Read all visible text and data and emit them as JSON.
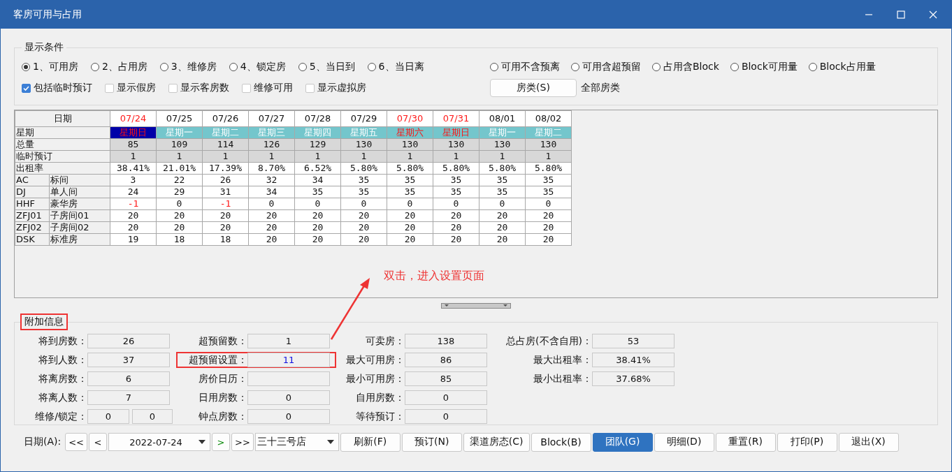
{
  "window": {
    "title": "客房可用与占用"
  },
  "conditions": {
    "title": "显示条件",
    "radios_left": [
      {
        "label": "1、可用房",
        "selected": true
      },
      {
        "label": "2、占用房",
        "selected": false
      },
      {
        "label": "3、维修房",
        "selected": false
      },
      {
        "label": "4、锁定房",
        "selected": false
      },
      {
        "label": "5、当日到",
        "selected": false
      },
      {
        "label": "6、当日离",
        "selected": false
      }
    ],
    "radios_right": [
      {
        "label": "可用不含预离",
        "selected": false
      },
      {
        "label": "可用含超预留",
        "selected": false
      },
      {
        "label": "占用含Block",
        "selected": false
      },
      {
        "label": "Block可用量",
        "selected": false
      },
      {
        "label": "Block占用量",
        "selected": false
      }
    ],
    "checkboxes": [
      {
        "label": "包括临时预订",
        "checked": true
      },
      {
        "label": "显示假房",
        "checked": false
      },
      {
        "label": "显示客房数",
        "checked": false
      },
      {
        "label": "维修可用",
        "checked": false
      },
      {
        "label": "显示虚拟房",
        "checked": false
      }
    ],
    "room_type_button": "房类(S)",
    "room_type_value": "全部房类"
  },
  "grid": {
    "header": "日期",
    "columns": [
      {
        "date": "07/24",
        "weekday": "星期日",
        "weekend": true,
        "selected": true
      },
      {
        "date": "07/25",
        "weekday": "星期一",
        "weekend": false,
        "selected": false
      },
      {
        "date": "07/26",
        "weekday": "星期二",
        "weekend": false,
        "selected": false
      },
      {
        "date": "07/27",
        "weekday": "星期三",
        "weekend": false,
        "selected": false
      },
      {
        "date": "07/28",
        "weekday": "星期四",
        "weekend": false,
        "selected": false
      },
      {
        "date": "07/29",
        "weekday": "星期五",
        "weekend": false,
        "selected": false
      },
      {
        "date": "07/30",
        "weekday": "星期六",
        "weekend": true,
        "selected": false
      },
      {
        "date": "07/31",
        "weekday": "星期日",
        "weekend": true,
        "selected": false
      },
      {
        "date": "08/01",
        "weekday": "星期一",
        "weekend": false,
        "selected": false
      },
      {
        "date": "08/02",
        "weekday": "星期二",
        "weekend": false,
        "selected": false
      }
    ],
    "weekday_label": "星期",
    "rows": [
      {
        "kind": "summary",
        "label": "总量",
        "values": [
          "85",
          "109",
          "114",
          "126",
          "129",
          "130",
          "130",
          "130",
          "130",
          "130"
        ]
      },
      {
        "kind": "summary",
        "label": "临时预订",
        "values": [
          "1",
          "1",
          "1",
          "1",
          "1",
          "1",
          "1",
          "1",
          "1",
          "1"
        ]
      },
      {
        "kind": "rate",
        "label": "出租率",
        "values": [
          "38.41%",
          "21.01%",
          "17.39%",
          "8.70%",
          "6.52%",
          "5.80%",
          "5.80%",
          "5.80%",
          "5.80%",
          "5.80%"
        ]
      },
      {
        "kind": "room",
        "code": "AC",
        "name": "标间",
        "values": [
          "3",
          "22",
          "26",
          "32",
          "34",
          "35",
          "35",
          "35",
          "35",
          "35"
        ],
        "alerts": [
          false,
          false,
          false,
          false,
          false,
          false,
          false,
          false,
          false,
          false
        ]
      },
      {
        "kind": "room",
        "code": "DJ",
        "name": "单人间",
        "values": [
          "24",
          "29",
          "31",
          "34",
          "35",
          "35",
          "35",
          "35",
          "35",
          "35"
        ],
        "alerts": [
          false,
          false,
          false,
          false,
          false,
          false,
          false,
          false,
          false,
          false
        ]
      },
      {
        "kind": "room",
        "code": "HHF",
        "name": "豪华房",
        "values": [
          "-1",
          "0",
          "-1",
          "0",
          "0",
          "0",
          "0",
          "0",
          "0",
          "0"
        ],
        "alerts": [
          true,
          false,
          true,
          false,
          false,
          false,
          false,
          false,
          false,
          false
        ]
      },
      {
        "kind": "room",
        "code": "ZFJ01",
        "name": "子房间01",
        "values": [
          "20",
          "20",
          "20",
          "20",
          "20",
          "20",
          "20",
          "20",
          "20",
          "20"
        ],
        "alerts": [
          false,
          false,
          false,
          false,
          false,
          false,
          false,
          false,
          false,
          false
        ]
      },
      {
        "kind": "room",
        "code": "ZFJ02",
        "name": "子房间02",
        "values": [
          "20",
          "20",
          "20",
          "20",
          "20",
          "20",
          "20",
          "20",
          "20",
          "20"
        ],
        "alerts": [
          false,
          false,
          false,
          false,
          false,
          false,
          false,
          false,
          false,
          false
        ]
      },
      {
        "kind": "room",
        "code": "DSK",
        "name": "标准房",
        "values": [
          "19",
          "18",
          "18",
          "20",
          "20",
          "20",
          "20",
          "20",
          "20",
          "20"
        ],
        "alerts": [
          false,
          false,
          false,
          false,
          false,
          false,
          false,
          false,
          false,
          false
        ]
      }
    ]
  },
  "annotation": {
    "text": "双击，进入设置页面"
  },
  "extra": {
    "title": "附加信息",
    "title_annotated": true,
    "rows": [
      [
        {
          "label": "将到房数：",
          "values": [
            "26"
          ]
        },
        {
          "label": "超预留数：",
          "values": [
            "1"
          ]
        },
        {
          "label": "可卖房：",
          "values": [
            "138"
          ]
        },
        {
          "label": "总占房(不含自用)：",
          "values": [
            "53"
          ]
        }
      ],
      [
        {
          "label": "将到人数：",
          "values": [
            "37"
          ]
        },
        {
          "label": "超预留设置：",
          "values": [
            "11"
          ],
          "annotated": true
        },
        {
          "label": "最大可用房：",
          "values": [
            "86"
          ]
        },
        {
          "label": "最大出租率：",
          "values": [
            "38.41%"
          ]
        }
      ],
      [
        {
          "label": "将离房数：",
          "values": [
            "6"
          ]
        },
        {
          "label": "房价日历："
        },
        {
          "label": "最小可用房：",
          "values": [
            "85"
          ]
        },
        {
          "label": "最小出租率：",
          "values": [
            "37.68%"
          ]
        }
      ],
      [
        {
          "label": "将离人数：",
          "values": [
            "7"
          ]
        },
        {
          "label": "日用房数：",
          "values": [
            "0"
          ]
        },
        {
          "label": "自用房数：",
          "values": [
            "0"
          ]
        }
      ],
      [
        {
          "label": "维修/锁定：",
          "values": [
            "0",
            "0"
          ]
        },
        {
          "label": "钟点房数：",
          "values": [
            "0"
          ]
        },
        {
          "label": "等待预订：",
          "values": [
            "0"
          ]
        }
      ]
    ]
  },
  "footer": {
    "date_label": "日期(A):",
    "first": "<<",
    "prev": "<",
    "date": "2022-07-24",
    "next": ">",
    "last": ">>",
    "hotel": "三十三号店",
    "buttons": [
      {
        "label": "刷新(F)",
        "selected": false
      },
      {
        "label": "预订(N)",
        "selected": false
      },
      {
        "label": "渠道房态(C)",
        "selected": false
      },
      {
        "label": "Block(B)",
        "selected": false
      },
      {
        "label": "团队(G)",
        "selected": true
      },
      {
        "label": "明细(D)",
        "selected": false
      },
      {
        "label": "重置(R)",
        "selected": false
      },
      {
        "label": "打印(P)",
        "selected": false
      },
      {
        "label": "退出(X)",
        "selected": false
      }
    ]
  }
}
